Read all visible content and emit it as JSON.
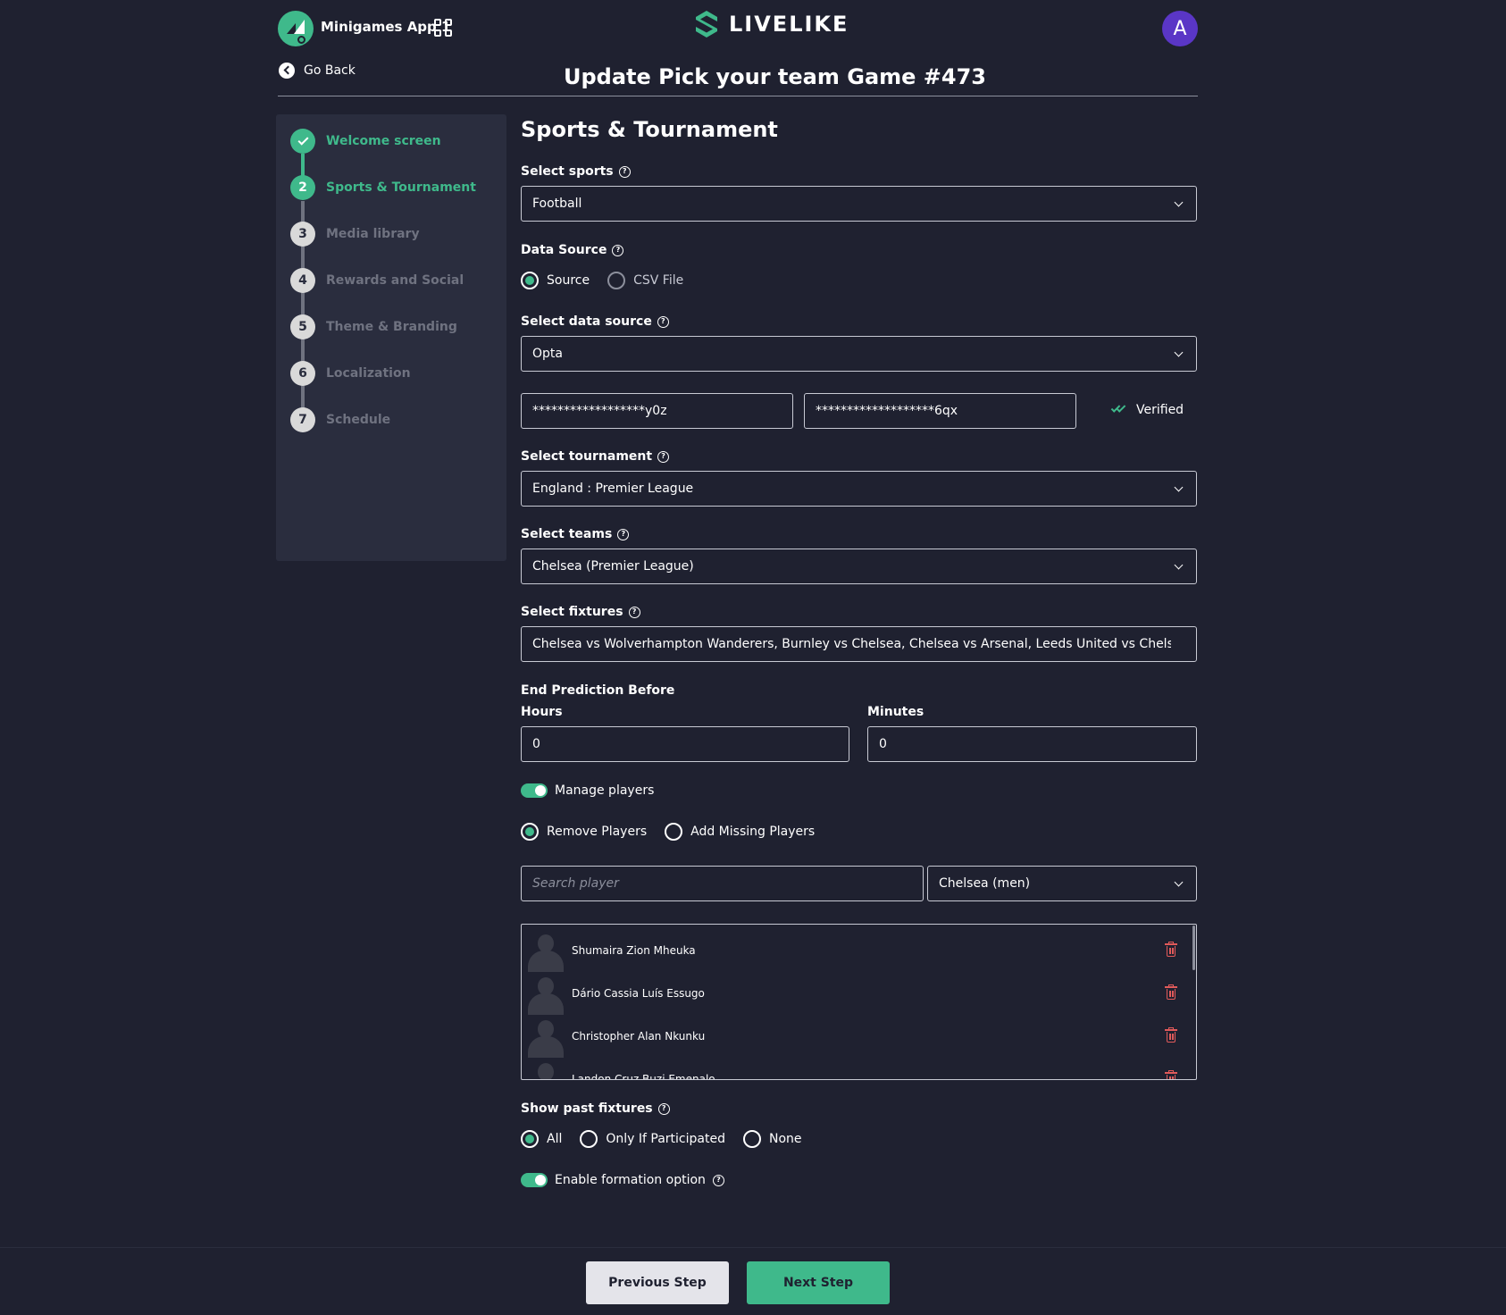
{
  "header": {
    "app_name": "Minigames App 1",
    "brand": "LIVELIKE",
    "avatar_initial": "A"
  },
  "nav": {
    "go_back": "Go Back"
  },
  "page_title": "Update Pick your team Game #473",
  "steps": [
    {
      "number": "",
      "label": "Welcome screen",
      "state": "done"
    },
    {
      "number": "2",
      "label": "Sports & Tournament",
      "state": "active"
    },
    {
      "number": "3",
      "label": "Media library",
      "state": "pending"
    },
    {
      "number": "4",
      "label": "Rewards and Social",
      "state": "pending"
    },
    {
      "number": "5",
      "label": "Theme & Branding",
      "state": "pending"
    },
    {
      "number": "6",
      "label": "Localization",
      "state": "pending"
    },
    {
      "number": "7",
      "label": "Schedule",
      "state": "pending"
    }
  ],
  "form": {
    "section_title": "Sports & Tournament",
    "select_sports": {
      "label": "Select sports",
      "value": "Football"
    },
    "data_source": {
      "label": "Data Source",
      "options": [
        "Source",
        "CSV File"
      ],
      "selected": "Source"
    },
    "select_data_source": {
      "label": "Select data source",
      "value": "Opta"
    },
    "credentials": {
      "key": "******************y0z",
      "secret": "*******************6qx",
      "status": "Verified"
    },
    "select_tournament": {
      "label": "Select tournament",
      "value": "England : Premier League"
    },
    "select_teams": {
      "label": "Select teams",
      "value": "Chelsea (Premier League)"
    },
    "select_fixtures": {
      "label": "Select fixtures",
      "value": "Chelsea vs Wolverhampton Wanderers, Burnley vs Chelsea, Chelsea vs Arsenal, Leeds United vs Chelsea, AFC..."
    },
    "end_prediction": {
      "label": "End Prediction Before",
      "hours_label": "Hours",
      "hours": "0",
      "minutes_label": "Minutes",
      "minutes": "0"
    },
    "manage_players": {
      "label": "Manage players",
      "on": true
    },
    "player_mode": {
      "options": [
        "Remove Players",
        "Add Missing Players"
      ],
      "selected": "Remove Players"
    },
    "search": {
      "placeholder": "Search player",
      "team_filter": "Chelsea (men)"
    },
    "players": [
      "Shumaira Zion Mheuka",
      "Dário Cassia Luís Essugo",
      "Christopher Alan Nkunku",
      "Landon Cruz Buzi Emenalo"
    ],
    "past_fixtures": {
      "label": "Show past fixtures",
      "options": [
        "All",
        "Only If Participated",
        "None"
      ],
      "selected": "All"
    },
    "formation_option": {
      "label": "Enable formation option",
      "on": true
    }
  },
  "footer": {
    "previous": "Previous Step",
    "next": "Next Step"
  },
  "colors": {
    "accent": "#3fb98b",
    "background": "#1f2130",
    "panel": "#2a2d3e",
    "danger": "#e05a5a",
    "avatar": "#5a36c6"
  }
}
